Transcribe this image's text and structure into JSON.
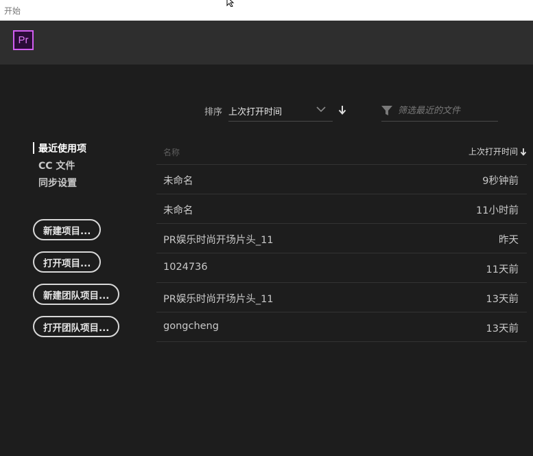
{
  "window": {
    "title": "开始"
  },
  "app": {
    "logo_text": "Pr"
  },
  "toolbar": {
    "sort_label": "排序",
    "sort_value": "上次打开时间",
    "filter_placeholder": "筛选最近的文件"
  },
  "sidebar": {
    "items": [
      {
        "label": "最近使用项",
        "active": true
      },
      {
        "label": "CC 文件",
        "active": false
      },
      {
        "label": "同步设置",
        "active": false
      }
    ],
    "buttons": [
      {
        "label": "新建项目..."
      },
      {
        "label": "打开项目..."
      },
      {
        "label": "新建团队项目..."
      },
      {
        "label": "打开团队项目..."
      }
    ]
  },
  "table": {
    "columns": {
      "name": "名称",
      "time": "上次打开时间"
    },
    "rows": [
      {
        "name": "未命名",
        "time": "9秒钟前"
      },
      {
        "name": "未命名",
        "time": "11小时前"
      },
      {
        "name": "PR娱乐时尚开场片头_11",
        "time": "昨天"
      },
      {
        "name": "1024736",
        "time": "11天前"
      },
      {
        "name": "PR娱乐时尚开场片头_11",
        "time": "13天前"
      },
      {
        "name": "gongcheng",
        "time": "13天前"
      }
    ]
  },
  "colors": {
    "background": "#1d1d1d",
    "header": "#2e2e2e",
    "accent_purple": "#d25ef2"
  }
}
